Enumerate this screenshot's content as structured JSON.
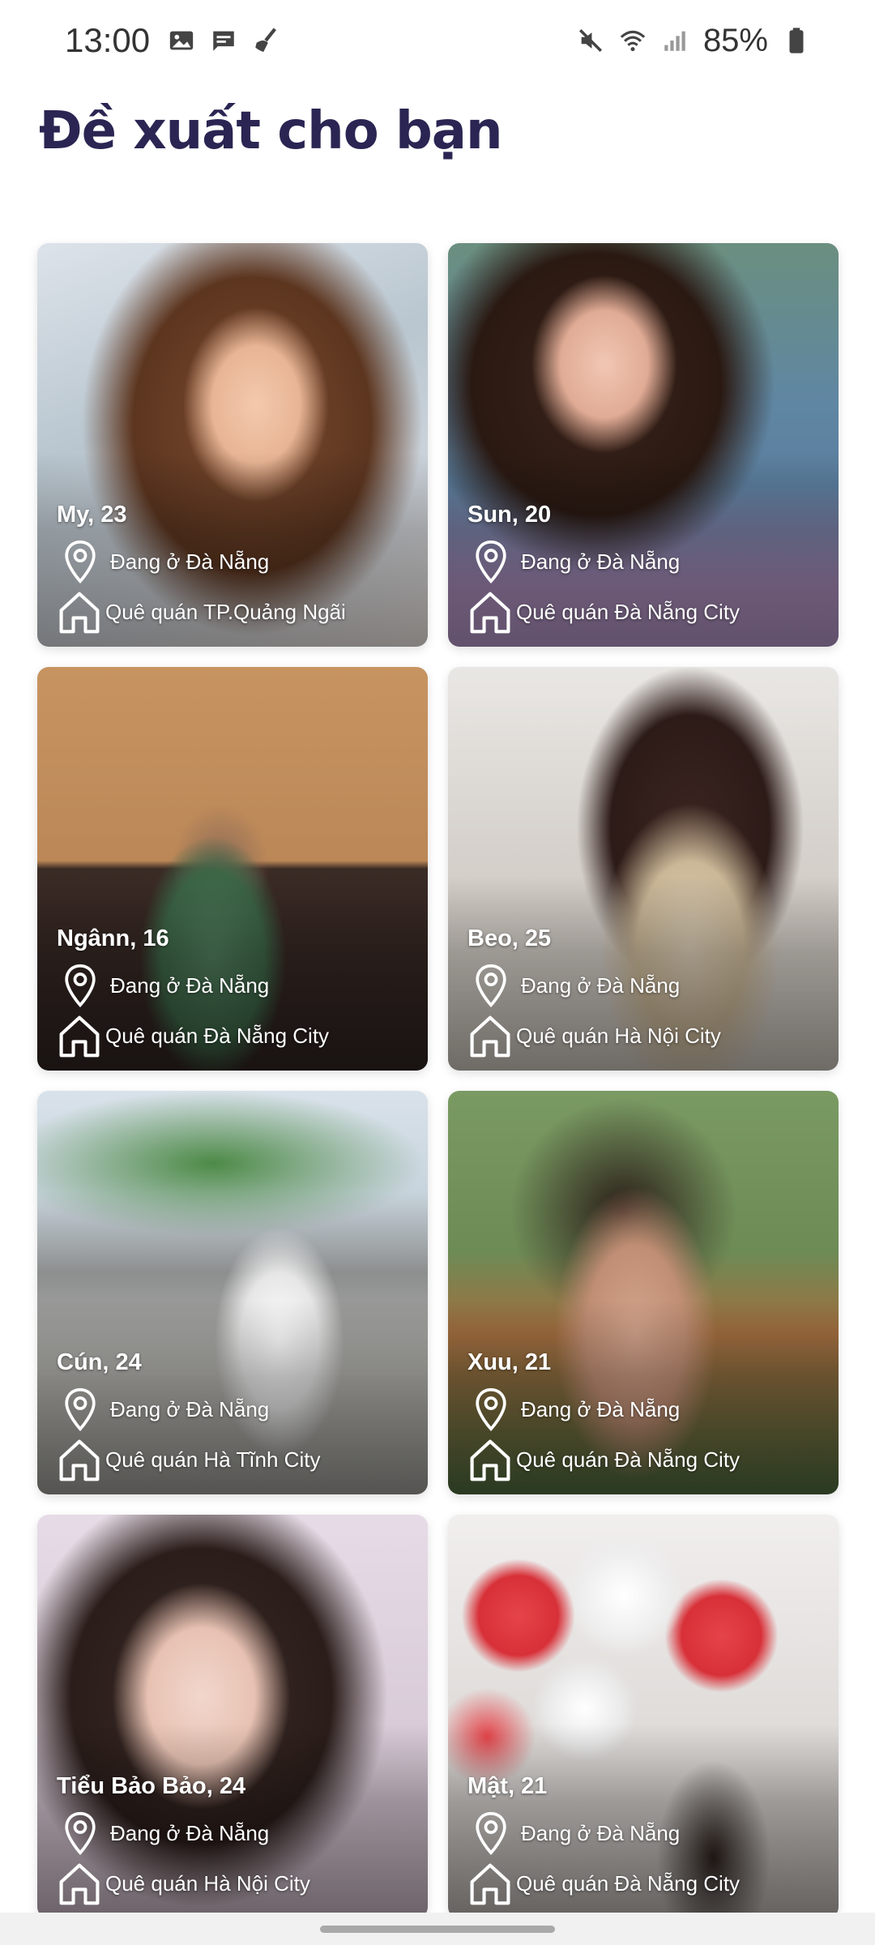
{
  "status_bar": {
    "time": "13:00",
    "battery": "85%",
    "left_icons": [
      "image-icon",
      "message-icon",
      "cleaner-icon"
    ],
    "right_icons": [
      "mute-icon",
      "wifi-icon",
      "signal-icon",
      "battery-icon"
    ]
  },
  "page": {
    "title": "Đề xuất cho bạn",
    "title_color": "#2a2552"
  },
  "profiles": [
    {
      "name": "My, 23",
      "location": "Đang ở Đà Nẵng",
      "hometown": "Quê quán TP.Quảng Ngãi"
    },
    {
      "name": "Sun, 20",
      "location": "Đang ở Đà Nẵng",
      "hometown": "Quê quán Đà Nẵng City"
    },
    {
      "name": "Ngânn, 16",
      "location": "Đang ở Đà Nẵng",
      "hometown": "Quê quán Đà Nẵng City"
    },
    {
      "name": "Beo, 25",
      "location": "Đang ở Đà Nẵng",
      "hometown": "Quê quán Hà Nội City"
    },
    {
      "name": "Cún, 24",
      "location": "Đang ở Đà Nẵng",
      "hometown": "Quê quán Hà Tĩnh City"
    },
    {
      "name": "Xuu, 21",
      "location": "Đang ở Đà Nẵng",
      "hometown": "Quê quán Đà Nẵng City"
    },
    {
      "name": "Tiểu Bảo Bảo, 24",
      "location": "Đang ở Đà Nẵng",
      "hometown": "Quê quán Hà Nội City"
    },
    {
      "name": "Mật, 21",
      "location": "Đang ở Đà Nẵng",
      "hometown": "Quê quán Đà Nẵng City"
    }
  ],
  "icons": {
    "location": "location-pin-icon",
    "hometown": "home-icon"
  }
}
